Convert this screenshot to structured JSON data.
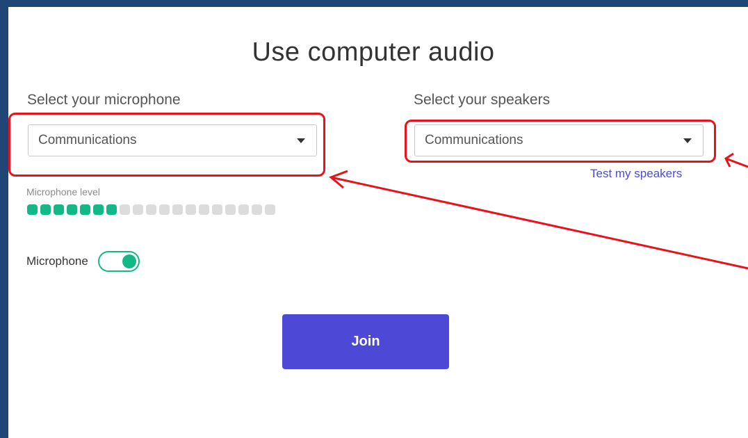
{
  "dialog": {
    "title": "Use computer audio",
    "join_label": "Join"
  },
  "microphone": {
    "label": "Select your microphone",
    "selected": "Communications",
    "level_label": "Microphone level",
    "level_active": 7,
    "level_total": 19,
    "toggle_label": "Microphone",
    "toggle_on": true
  },
  "speakers": {
    "label": "Select your speakers",
    "selected": "Communications",
    "test_link": "Test my speakers"
  },
  "colors": {
    "background": "#1f4677",
    "accent": "#12b886",
    "button": "#4d48d6",
    "link": "#4c4cd4",
    "annotation": "#e8121a"
  }
}
